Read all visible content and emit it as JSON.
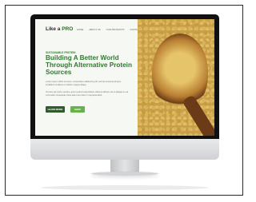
{
  "site": {
    "logo_main": "Like a",
    "logo_pro": "PRO",
    "nav": [
      "HOME",
      "ABOUT US",
      "OUR PRODUCTS",
      "CONTACT"
    ],
    "eyebrow": "SUSTAINABLE PROTEIN",
    "headline": "Building A Better World Through Alternative Protein Sources",
    "paragraph1": "Lorem ipsum dolor sit amet, consectetur adipiscing elit, sed do eiusmod tempor incididunt ut labore et dolore magna aliqua.",
    "paragraph2": "Ut enim ad minim veniam, quis nostrud exercitation ullamco laboris nisi ut aliquip ex ea commodo consequat. Duis aute irure dolor in reprehenderit.",
    "button_primary": "LEARN MORE",
    "button_secondary": "SHOP"
  },
  "colors": {
    "accent": "#2f7a2f",
    "button_dark": "#2f5b2d",
    "button_light": "#67b34a"
  }
}
